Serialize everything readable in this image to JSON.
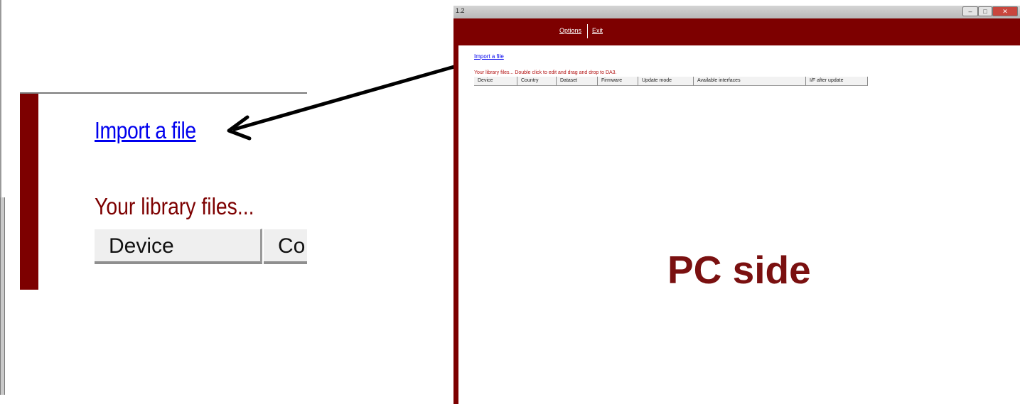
{
  "window": {
    "title": "1.2",
    "controls": {
      "minimize": "–",
      "maximize": "□",
      "close": "✕"
    }
  },
  "menu": {
    "options_label": "Options",
    "exit_label": "Exit"
  },
  "main": {
    "import_link": "Import a file",
    "info_text": "Your library files...   Double click to edit and drag and drop to DA3.",
    "table_headers": [
      "Device",
      "Country",
      "Dataset",
      "Firmware",
      "Update mode",
      "Available interfaces",
      "I/F after update"
    ]
  },
  "zoom": {
    "import_link": "Import a file",
    "library_text": "Your library files...",
    "headers": [
      "Device",
      "Co"
    ]
  },
  "overlay_label": "PC side",
  "colors": {
    "maroon": "#7d0000",
    "link_blue": "#0000ee",
    "label_red": "#7a1010"
  }
}
